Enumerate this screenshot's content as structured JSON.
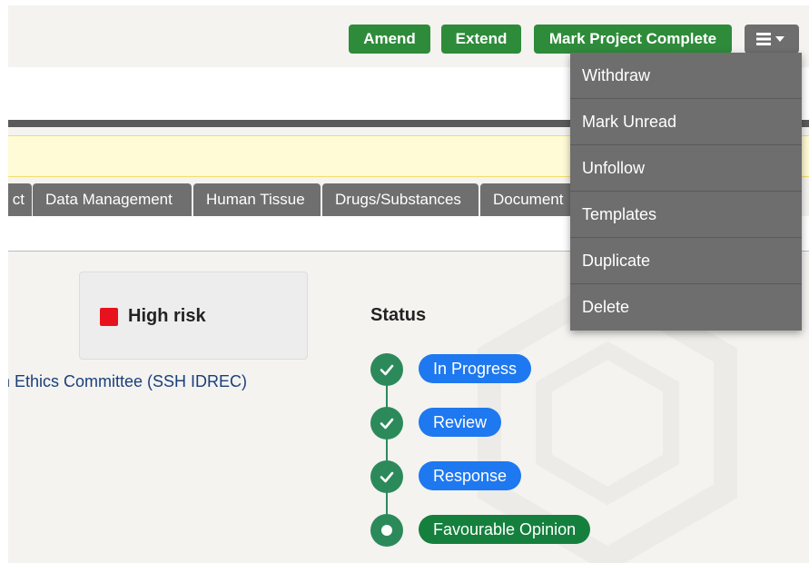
{
  "toolbar": {
    "amend_label": "Amend",
    "extend_label": "Extend",
    "complete_label": "Mark Project Complete",
    "menu_icon": "hamburger-caret-icon"
  },
  "menu": {
    "items": [
      "Withdraw",
      "Mark Unread",
      "Unfollow",
      "Templates",
      "Duplicate",
      "Delete"
    ]
  },
  "tabs": [
    "ct",
    "Data Management",
    "Human Tissue",
    "Drugs/Substances",
    "Document"
  ],
  "risk": {
    "label": "High risk",
    "color": "#e8121e"
  },
  "committee_text": "n Ethics Committee (SSH IDREC)",
  "status": {
    "heading": "Status",
    "steps": [
      {
        "label": "In Progress",
        "state": "done"
      },
      {
        "label": "Review",
        "state": "done"
      },
      {
        "label": "Response",
        "state": "done"
      },
      {
        "label": "Favourable Opinion",
        "state": "current"
      }
    ]
  },
  "colors": {
    "button_green": "#2e8b3a",
    "menu_grey": "#6e6e6e",
    "pill_blue": "#1e78f0",
    "pill_green": "#15803d",
    "timeline_green": "#2c8a5a"
  }
}
